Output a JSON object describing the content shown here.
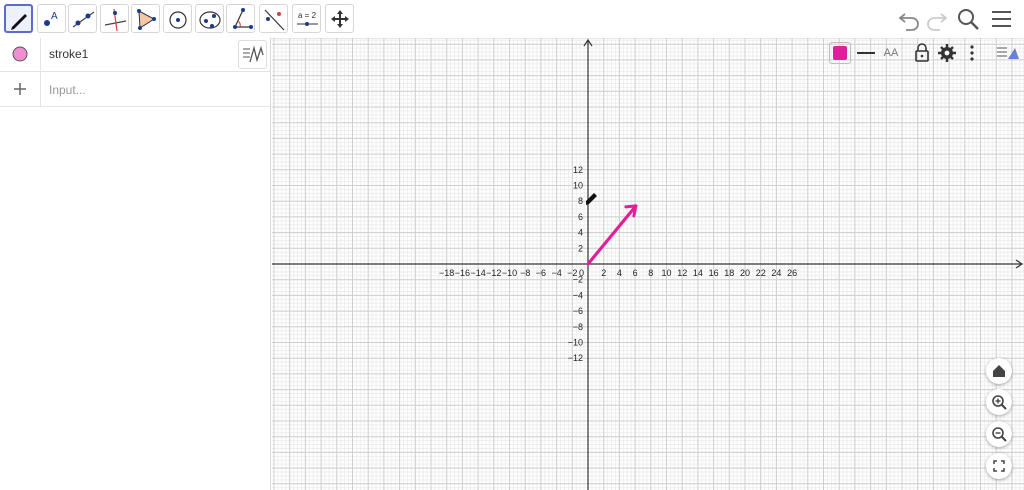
{
  "app": {
    "accent_color": "#5a6bd1",
    "stroke_color": "#e0209b"
  },
  "toolbar": {
    "tools": [
      {
        "name": "pen-tool",
        "icon": "pencil-icon"
      },
      {
        "name": "point-tool",
        "icon": "point-icon",
        "label": "A"
      },
      {
        "name": "line-tool",
        "icon": "line-icon"
      },
      {
        "name": "perpendicular-tool",
        "icon": "perpendicular-icon"
      },
      {
        "name": "polygon-tool",
        "icon": "polygon-icon"
      },
      {
        "name": "circle-tool",
        "icon": "circle-icon"
      },
      {
        "name": "conic-tool",
        "icon": "ellipse-icon"
      },
      {
        "name": "angle-tool",
        "icon": "angle-icon"
      },
      {
        "name": "reflect-tool",
        "icon": "reflect-icon"
      },
      {
        "name": "slider-tool",
        "icon": "slider-icon",
        "label": "a = 2"
      },
      {
        "name": "move-graphics-tool",
        "icon": "move-icon"
      }
    ],
    "right_icons": [
      "undo-icon",
      "redo-icon",
      "search-icon",
      "menu-icon"
    ]
  },
  "algebra": {
    "items": [
      {
        "label": "stroke1",
        "color": "#f08fd0"
      }
    ],
    "input_placeholder": "Input..."
  },
  "style_bar": {
    "color": "#e0209b",
    "font_button_label": "AA",
    "icons": [
      "line-style-icon",
      "text-style-icon",
      "lock-icon",
      "gear-icon",
      "more-vertical-icon",
      "graphics-toggle-icon"
    ]
  },
  "graph": {
    "x_ticks": [
      "−18",
      "−16",
      "−14",
      "−12",
      "−10",
      "−8",
      "−6",
      "−4",
      "−2",
      "0",
      "2",
      "4",
      "6",
      "8",
      "10",
      "12",
      "14",
      "16",
      "18",
      "20",
      "22",
      "24",
      "26"
    ],
    "y_ticks": [
      "12",
      "10",
      "8",
      "6",
      "4",
      "2",
      "−2",
      "−4",
      "−6",
      "−8",
      "−10",
      "−12"
    ],
    "x_tick_values": [
      -18,
      -16,
      -14,
      -12,
      -10,
      -8,
      -6,
      -4,
      -2,
      0,
      2,
      4,
      6,
      8,
      10,
      12,
      14,
      16,
      18,
      20,
      22,
      24,
      26
    ],
    "y_tick_values": [
      12,
      10,
      8,
      6,
      4,
      2,
      -2,
      -4,
      -6,
      -8,
      -10,
      -12
    ],
    "stroke": {
      "from": [
        0,
        0
      ],
      "to": [
        6.1,
        7.4
      ]
    }
  },
  "nav_buttons": [
    "home-icon",
    "zoom-in-icon",
    "zoom-out-icon",
    "fullscreen-icon"
  ]
}
